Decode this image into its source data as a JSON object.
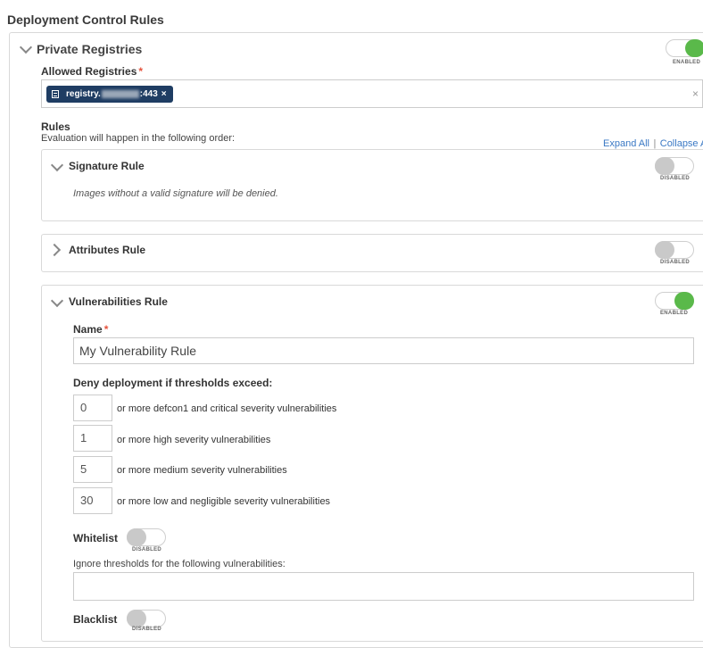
{
  "page_title": "Deployment Control Rules",
  "private_registries": {
    "title": "Private Registries",
    "toggle_caption": "ENABLED",
    "allowed_label": "Allowed Registries",
    "tag_prefix": "registry.",
    "tag_suffix": ":443",
    "tag_remove": "×",
    "clear": "×"
  },
  "rules": {
    "heading": "Rules",
    "subheading": "Evaluation will happen in the following order:",
    "expand_all": "Expand All",
    "separator": "|",
    "collapse_all": "Collapse A"
  },
  "signature_rule": {
    "title": "Signature Rule",
    "toggle_caption": "DISABLED",
    "description": "Images without a valid signature will be denied."
  },
  "attributes_rule": {
    "title": "Attributes Rule",
    "toggle_caption": "DISABLED"
  },
  "vulnerabilities_rule": {
    "title": "Vulnerabilities Rule",
    "toggle_caption": "ENABLED",
    "name_label": "Name",
    "name_value": "My Vulnerability Rule",
    "thresholds_heading": "Deny deployment if thresholds exceed:",
    "thresholds": [
      {
        "value": "0",
        "label": "or more defcon1 and critical severity vulnerabilities"
      },
      {
        "value": "1",
        "label": "or more high severity vulnerabilities"
      },
      {
        "value": "5",
        "label": "or more medium severity vulnerabilities"
      },
      {
        "value": "30",
        "label": "or more low and negligible severity vulnerabilities"
      }
    ],
    "whitelist_label": "Whitelist",
    "whitelist_caption": "DISABLED",
    "ignore_text": "Ignore thresholds for the following vulnerabilities:",
    "blacklist_label": "Blacklist",
    "blacklist_caption": "DISABLED"
  },
  "colors": {
    "toggle_on": "#5ab94a",
    "toggle_off": "#c9c9c9",
    "tag_bg": "#1f3d63",
    "link": "#3a78c4",
    "required": "#e5533d"
  }
}
